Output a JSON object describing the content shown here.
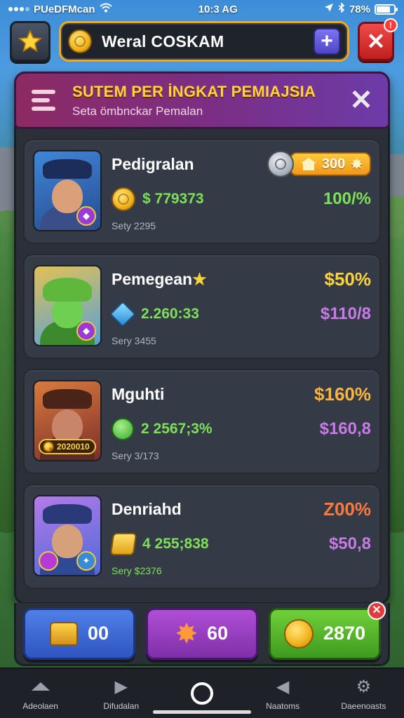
{
  "status": {
    "carrier": "PUeDFMcan",
    "time": "10:3 AG",
    "battery": "78%",
    "battery_level": 0.78
  },
  "header": {
    "game_title": "Weral COSKAM",
    "plus_label": "+",
    "close_label": "✕",
    "notif": "!"
  },
  "panel": {
    "title": "SUTEM PER İNGKAT PEMIAJSIA",
    "subtitle": "Seta ömbnckar Pemalan",
    "close_label": "✕"
  },
  "players": [
    {
      "name": "Pedigralan",
      "reward": "300",
      "score": "$ 779373",
      "sub": "Sety 2295",
      "right": "100/%",
      "right_color": "#7ee05a"
    },
    {
      "name": "Pemegean",
      "name_star": "★",
      "top_right": "$50%",
      "top_right_color": "#ffd43b",
      "score": "2.260:33",
      "sub": "Sery 3455",
      "right": "$110/8",
      "right_color": "#c77ae8"
    },
    {
      "name": "Mguhti",
      "top_right": "$160%",
      "top_right_color": "#ffb43b",
      "score": "2 2567;3%",
      "sub": "Sery 3/173",
      "right": "$160,8",
      "right_color": "#c77ae8",
      "badge_text": "2020010"
    },
    {
      "name": "Denriahd",
      "top_right": "Z00%",
      "top_right_color": "#ff7a3a",
      "score": "4 255;838",
      "sub": "Sery $2376",
      "right": "$50,8",
      "right_color": "#c77ae8"
    }
  ],
  "currency": {
    "chests": "00",
    "gems": "60",
    "coins": "2870",
    "error_label": "✕"
  },
  "nav": [
    {
      "label": "Adeolaen",
      "icon": "home-icon"
    },
    {
      "label": "Difudalan",
      "icon": "play-icon"
    },
    {
      "label": "",
      "icon": "circle-icon"
    },
    {
      "label": "Naatoms",
      "icon": "tag-icon"
    },
    {
      "label": "Daeenoasts",
      "icon": "settings-icon"
    }
  ]
}
